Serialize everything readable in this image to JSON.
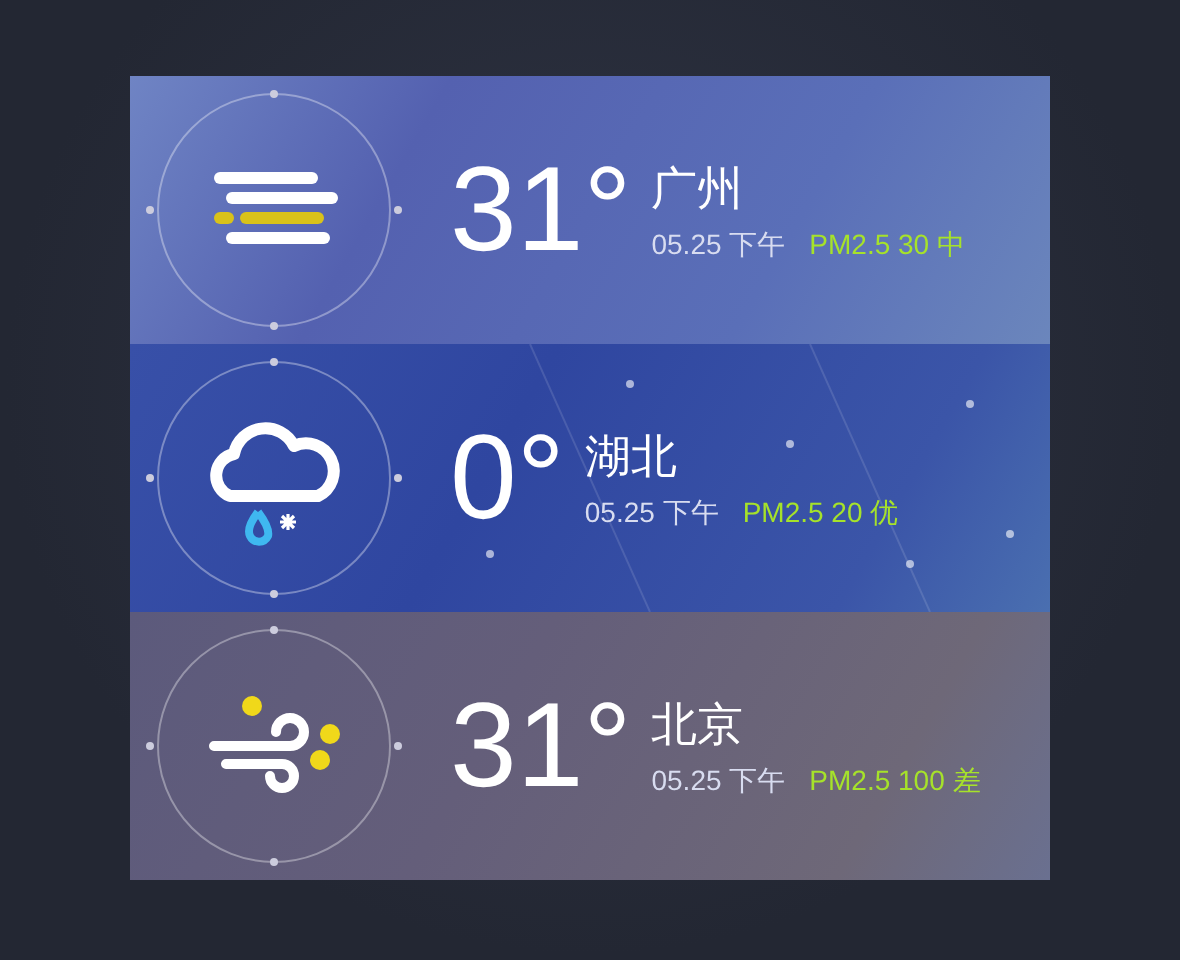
{
  "cards": [
    {
      "kind": "haze",
      "temperature": "31°",
      "city": "广州",
      "date": "05.25 下午",
      "air_quality": "PM2.5 30 中"
    },
    {
      "kind": "sleet",
      "temperature": "0°",
      "city": "湖北",
      "date": "05.25 下午",
      "air_quality": "PM2.5 20 优"
    },
    {
      "kind": "wind",
      "temperature": "31°",
      "city": "北京",
      "date": "05.25 下午",
      "air_quality": "PM2.5 100 差"
    }
  ]
}
